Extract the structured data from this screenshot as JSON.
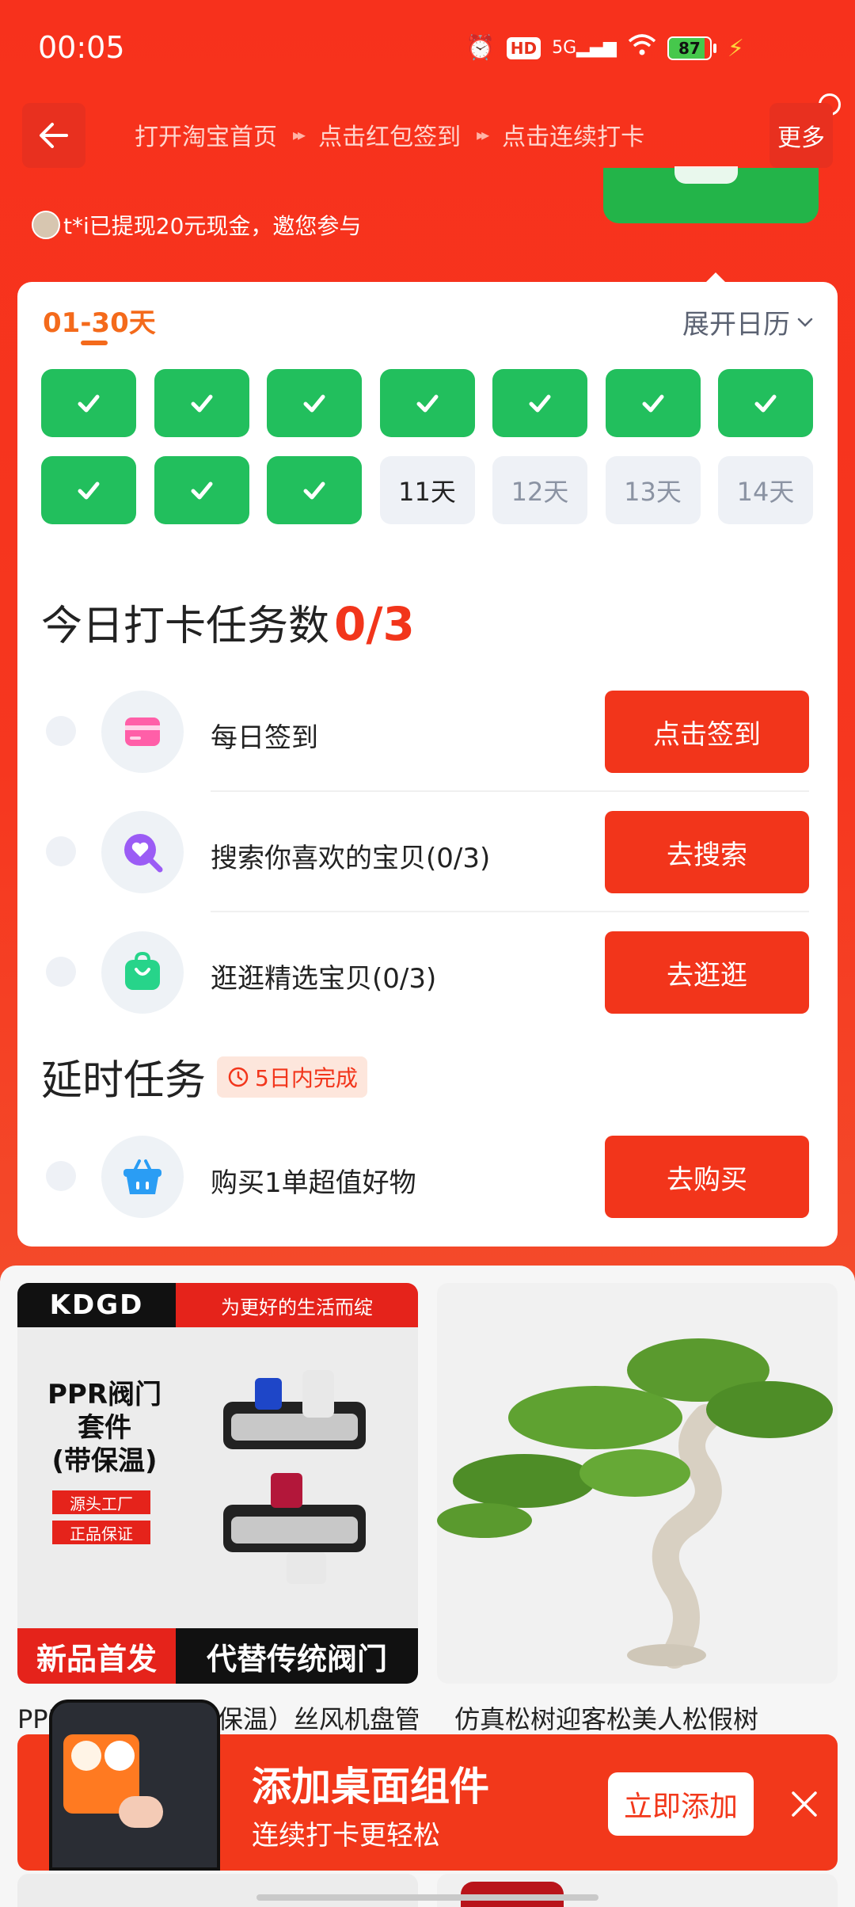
{
  "status_bar": {
    "time": "00:05",
    "network": "5G",
    "hd": "HD",
    "battery": "87",
    "battery_level": 0.87
  },
  "nav": {
    "steps": [
      "打开淘宝首页",
      "点击红包签到",
      "点击连续打卡"
    ],
    "separator": "▸▸",
    "more_label": "更多"
  },
  "ticker_text": "t*i已提现20元现金，邀您参与",
  "calendar": {
    "range_label": "01-30天",
    "toggle_label": "展开日历",
    "days": [
      {
        "label": "",
        "done": true
      },
      {
        "label": "",
        "done": true
      },
      {
        "label": "",
        "done": true
      },
      {
        "label": "",
        "done": true
      },
      {
        "label": "",
        "done": true
      },
      {
        "label": "",
        "done": true
      },
      {
        "label": "",
        "done": true
      },
      {
        "label": "",
        "done": true
      },
      {
        "label": "",
        "done": true
      },
      {
        "label": "",
        "done": true
      },
      {
        "label": "11天",
        "done": false,
        "today": true
      },
      {
        "label": "12天",
        "done": false
      },
      {
        "label": "13天",
        "done": false
      },
      {
        "label": "14天",
        "done": false
      }
    ]
  },
  "today_tasks": {
    "title": "今日打卡任务数",
    "count": "0/3",
    "items": [
      {
        "label": "每日签到",
        "button": "点击签到",
        "icon": "card-icon"
      },
      {
        "label": "搜索你喜欢的宝贝(0/3)",
        "button": "去搜索",
        "icon": "search-heart-icon"
      },
      {
        "label": "逛逛精选宝贝(0/3)",
        "button": "去逛逛",
        "icon": "shopping-bag-icon"
      }
    ]
  },
  "delayed_tasks": {
    "title": "延时任务",
    "badge": "5日内完成",
    "items": [
      {
        "label": "购买1单超值好物",
        "button": "去购买",
        "icon": "basket-icon"
      }
    ]
  },
  "products": [
    {
      "title": "PPR阀门套件带保温丝风机盘管套",
      "visible_title": "PPR阀门套件（带保温）丝风机盘管套",
      "logo": "KDGD",
      "slogan": "为更好的生活而绽",
      "image_name": "PPR阀门\n套件\n(带保温)",
      "tags": [
        "源头工厂",
        "正品保证"
      ],
      "banner_left": "新品首发",
      "banner_right": "代替传统阀门"
    },
    {
      "title": "仿真松树迎客松美人松假树"
    }
  ],
  "widget_banner": {
    "title": "添加桌面组件",
    "subtitle": "连续打卡更轻松",
    "add_label": "立即添加"
  },
  "colors": {
    "brand_red": "#f2351b",
    "check_green": "#22bf5d",
    "range_orange": "#f46a1b"
  }
}
